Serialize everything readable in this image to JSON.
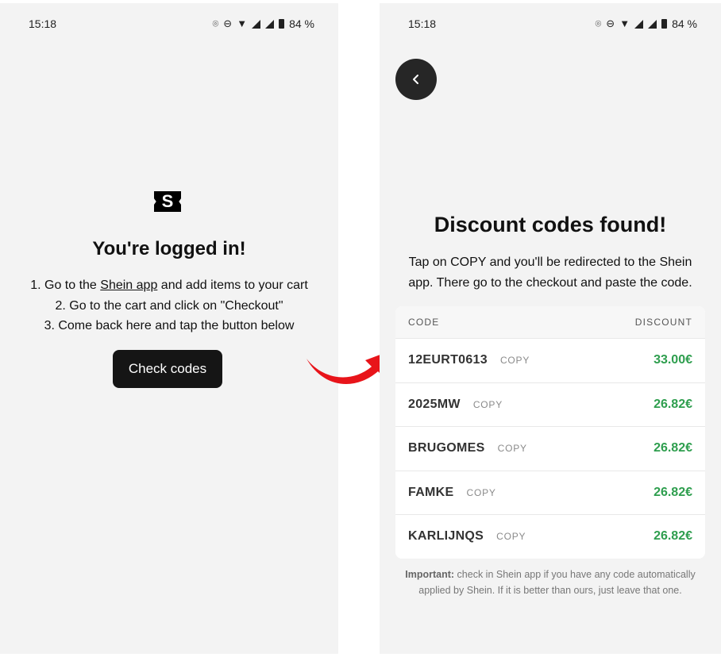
{
  "status_bar": {
    "time": "15:18",
    "battery": "84 %"
  },
  "left_screen": {
    "logo_letter": "S",
    "title": "You're logged in!",
    "step1_prefix": "1. Go to the ",
    "step1_link": "Shein app",
    "step1_suffix": " and add items to your cart",
    "step2": "2. Go to the cart and click on \"Checkout\"",
    "step3": "3. Come back here and tap the button below",
    "button_label": "Check codes"
  },
  "right_screen": {
    "title": "Discount codes found!",
    "description": "Tap on COPY and you'll be redirected to the Shein app. There go to the checkout and paste the code.",
    "table": {
      "header_code": "CODE",
      "header_discount": "DISCOUNT",
      "rows": [
        {
          "code": "12EURT0613",
          "copy": "COPY",
          "discount": "33.00€"
        },
        {
          "code": "2025MW",
          "copy": "COPY",
          "discount": "26.82€"
        },
        {
          "code": "BRUGOMES",
          "copy": "COPY",
          "discount": "26.82€"
        },
        {
          "code": "FAMKE",
          "copy": "COPY",
          "discount": "26.82€"
        },
        {
          "code": "KARLIJNQS",
          "copy": "COPY",
          "discount": "26.82€"
        }
      ]
    },
    "note_bold": "Important:",
    "note_text": " check in Shein app if you have any code automatically applied by Shein. If it is better than ours, just leave that one."
  },
  "colors": {
    "discount_green": "#2e9e4e",
    "arrow_red": "#e8141a",
    "button_dark": "#151515"
  }
}
